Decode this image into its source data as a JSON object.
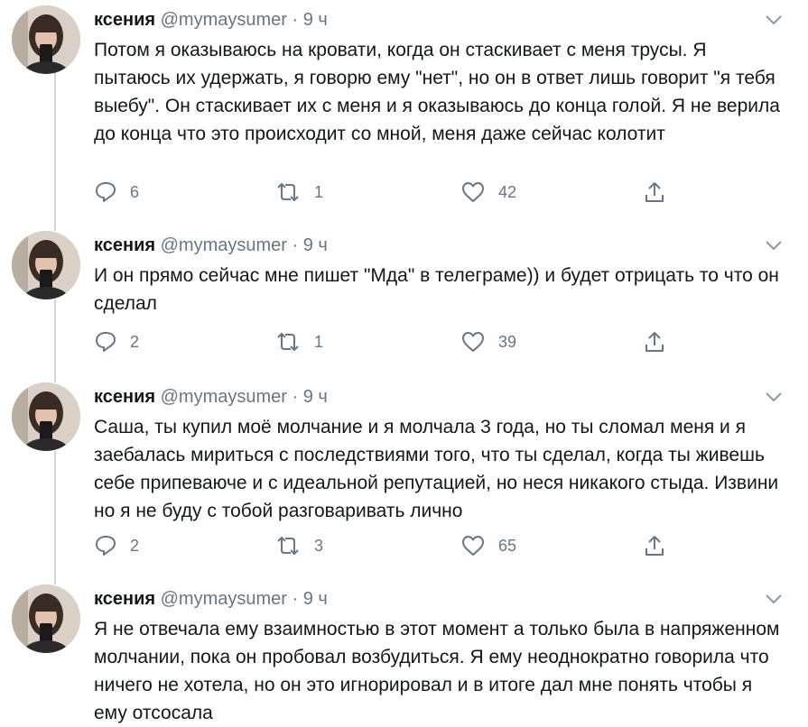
{
  "tweets": [
    {
      "name": "ксения",
      "handle": "@mymaysumer",
      "dot": "·",
      "time": "9 ч",
      "text": "Потом я оказываюсь на кровати, когда он стаскивает с меня трусы. Я пытаюсь их удержать, я говорю ему \"нет\", но он в ответ лишь говорит \"я тебя выебу\". Он стаскивает их с меня и я оказываюсь до конца голой. Я не верила до конца что это происходит со мной, меня даже сейчас колотит",
      "replies": "6",
      "retweets": "1",
      "likes": "42"
    },
    {
      "name": "ксения",
      "handle": "@mymaysumer",
      "dot": "·",
      "time": "9 ч",
      "text": "И он прямо сейчас мне пишет \"Мда\" в телеграме)) и будет отрицать то что он сделал",
      "replies": "2",
      "retweets": "1",
      "likes": "39"
    },
    {
      "name": "ксения",
      "handle": "@mymaysumer",
      "dot": "·",
      "time": "9 ч",
      "text": "Саша, ты купил моё молчание и я молчала 3 года, но ты сломал меня и я заебалась мириться с последствиями того, что ты сделал, когда ты живешь себе припеваюче и с идеальной репутацией, но неся никакого стыда. Извини но я не буду с тобой разговаривать лично",
      "replies": "2",
      "retweets": "3",
      "likes": "65"
    },
    {
      "name": "ксения",
      "handle": "@mymaysumer",
      "dot": "·",
      "time": "9 ч",
      "text": "Я не отвечала ему взаимностью в этот момент а только была в напряженном молчании, пока он пробовал возбудиться. Я ему неоднократно говорила что ничего не хотела, но он это игнорировал и в итоге дал мне понять чтобы я ему отсосала"
    }
  ],
  "colors": {
    "text": "#14171a",
    "secondary": "#657786",
    "thread_line": "#ccd6dd"
  },
  "icons": {
    "reply": "reply-icon",
    "retweet": "retweet-icon",
    "like": "like-icon",
    "share": "share-icon",
    "menu": "chevron-down-icon"
  }
}
